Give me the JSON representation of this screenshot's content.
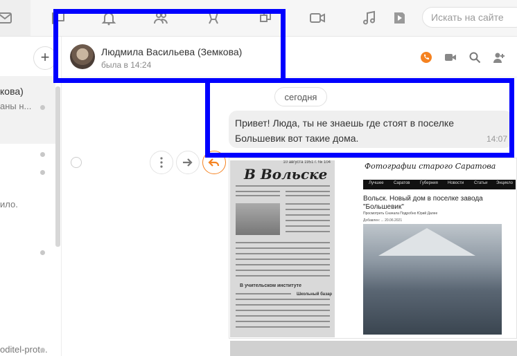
{
  "toolbar": {
    "icons": [
      "mail-icon",
      "chat-icon",
      "bell-icon",
      "friends-icon",
      "guests-icon",
      "discussions-icon",
      "video-icon",
      "music-icon",
      "video-play-icon"
    ],
    "search_placeholder": "Искать на сайте"
  },
  "sidebar": {
    "add_label": "+",
    "conversations": [
      {
        "name": "кова)",
        "sub": "аны н...",
        "active": true
      },
      {
        "name": "",
        "sub": "",
        "active": false
      },
      {
        "name": "",
        "sub": "ило.",
        "active": false
      },
      {
        "name": "",
        "sub": "",
        "active": false
      },
      {
        "name": "",
        "sub": "oditel-prot...",
        "active": false
      }
    ]
  },
  "chat": {
    "contact_name": "Людмила Васильева (Земкова)",
    "contact_status": "была в 14:24",
    "header_icons": [
      "call-icon",
      "video-call-icon",
      "search-icon",
      "add-user-icon"
    ],
    "accent_color": "#f58220",
    "date_separator": "сегодня",
    "message": {
      "text": "Привет! Люда, ты не знаешь где стоят в поселке Большевик вот такие дома.",
      "time": "14:07"
    }
  },
  "attachments": {
    "newspaper": {
      "title": "В Вольске",
      "date": "10 августа 1951 г. № 104",
      "subheading": "В учительском институте",
      "subheading2": "Школьный базар"
    },
    "website": {
      "brand": "Фотографии старого Саратова",
      "nav": [
        "Лучшее",
        "Саратов",
        "Губерния",
        "Новости",
        "Статьи",
        "Энцикло"
      ],
      "title": "Вольск. Новый дом в поселке завода \"Большевик\"",
      "tabs": "Просмотреть   Сначала   Подробно   Юрий   Далее",
      "meta": "Добавлен: ... 20.06.2021"
    }
  }
}
